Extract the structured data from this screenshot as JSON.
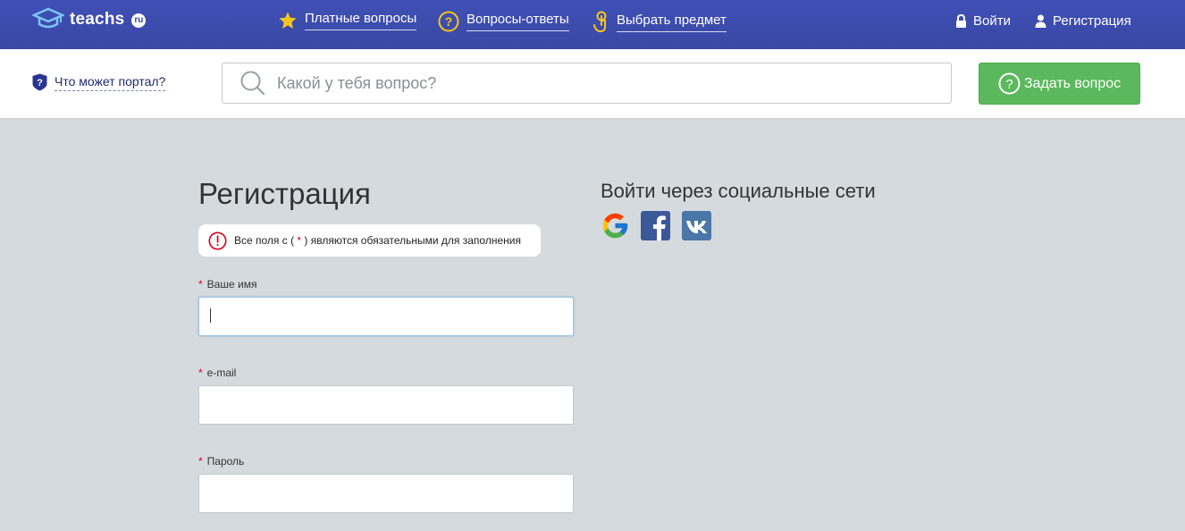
{
  "header": {
    "logo_text": "teachs",
    "logo_suffix": "ru",
    "nav": [
      {
        "label": "Платные вопросы",
        "icon": "star-icon"
      },
      {
        "label": "Вопросы-ответы",
        "icon": "question-circle-icon"
      },
      {
        "label": "Выбрать предмет",
        "icon": "pointer-hand-icon"
      }
    ],
    "login_label": "Войти",
    "register_label": "Регистрация"
  },
  "subbar": {
    "portal_link": "Что может портал?",
    "search_placeholder": "Какой у тебя вопрос?",
    "ask_button": "Задать вопрос"
  },
  "form": {
    "title": "Регистрация",
    "notice_prefix": "Все поля с ( ",
    "notice_star": "*",
    "notice_suffix": " ) являются обязательными для заполнения",
    "required_mark": "*",
    "fields": [
      {
        "label": "Ваше имя",
        "value": ""
      },
      {
        "label": "e-mail",
        "value": ""
      },
      {
        "label": "Пароль",
        "value": ""
      }
    ]
  },
  "social": {
    "title": "Войти через социальные сети",
    "networks": [
      "google-icon",
      "facebook-icon",
      "vk-icon"
    ]
  },
  "colors": {
    "header_bg": "#3f50b5",
    "page_bg": "#d5dade",
    "accent_green": "#5cb85c",
    "required_red": "#d0021b",
    "nav_icon_yellow": "#f5c518"
  }
}
